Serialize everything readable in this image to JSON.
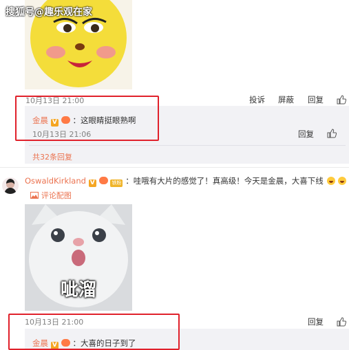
{
  "watermark": "搜狐号@趣乐观在家",
  "post1": {
    "timestamp": "10月13日 21:00",
    "actions": [
      "投诉",
      "屏蔽",
      "回复"
    ],
    "reply": {
      "author": "金晨",
      "text": "：这眼睛挺眼熟啊",
      "timestamp": "10月13日 21:06",
      "action": "回复"
    },
    "replies_count": "共32条回复"
  },
  "post2": {
    "author": "OswaldKirkland",
    "badge_text": "铁粉",
    "text": "：哇哦有大片的感觉了！真高级！今天是金晨，大喜下线",
    "comment_image_link": "评论配图",
    "image_caption": "呲溜",
    "timestamp": "10月13日 21:00",
    "action": "回复",
    "reply": {
      "author": "金晨",
      "text": "：大喜的日子到了"
    }
  },
  "colors": {
    "link": "#eb7350",
    "highlight_box": "#e0202a",
    "reply_bg": "#f2f2f5"
  }
}
